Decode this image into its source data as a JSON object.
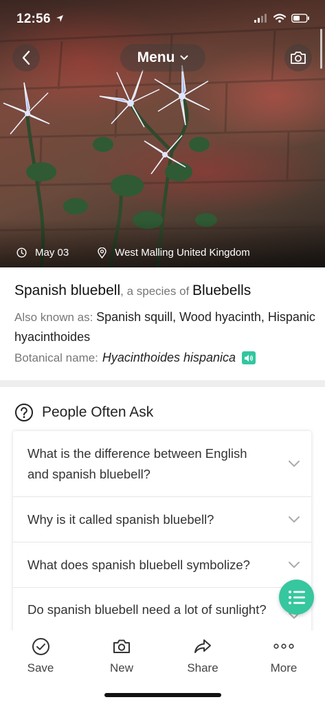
{
  "status_bar": {
    "time": "12:56"
  },
  "nav": {
    "menu_label": "Menu"
  },
  "photo": {
    "date": "May 03",
    "location": "West Malling United Kingdom"
  },
  "plant": {
    "common_name": "Spanish bluebell",
    "species_of_prefix": ", a species of ",
    "genus": "Bluebells",
    "aka_label": "Also known as: ",
    "aka_names": "Spanish squill, Wood hyacinth, Hispanic hyacinthoides",
    "botanical_label": "Botanical name:",
    "botanical_name": "Hyacinthoides hispanica"
  },
  "faq": {
    "title": "People Often Ask",
    "items": [
      {
        "question": "What is the difference between English and spanish bluebell?"
      },
      {
        "question": "Why is it called spanish bluebell?"
      },
      {
        "question": "What does spanish bluebell symbolize?"
      },
      {
        "question": "Do spanish bluebell need a lot of sunlight?"
      }
    ]
  },
  "tabbar": {
    "save": "Save",
    "new": "New",
    "share": "Share",
    "more": "More"
  },
  "colors": {
    "accent": "#36c79f",
    "speaker": "#32c6a0"
  },
  "icons": [
    "location-arrow-icon",
    "signal-icon",
    "wifi-icon",
    "battery-icon",
    "back-arrow-icon",
    "chevron-down-icon",
    "camera-icon",
    "clock-icon",
    "location-pin-icon",
    "speaker-icon",
    "question-circle-icon",
    "list-icon",
    "check-circle-icon",
    "share-icon",
    "more-dots-icon"
  ]
}
